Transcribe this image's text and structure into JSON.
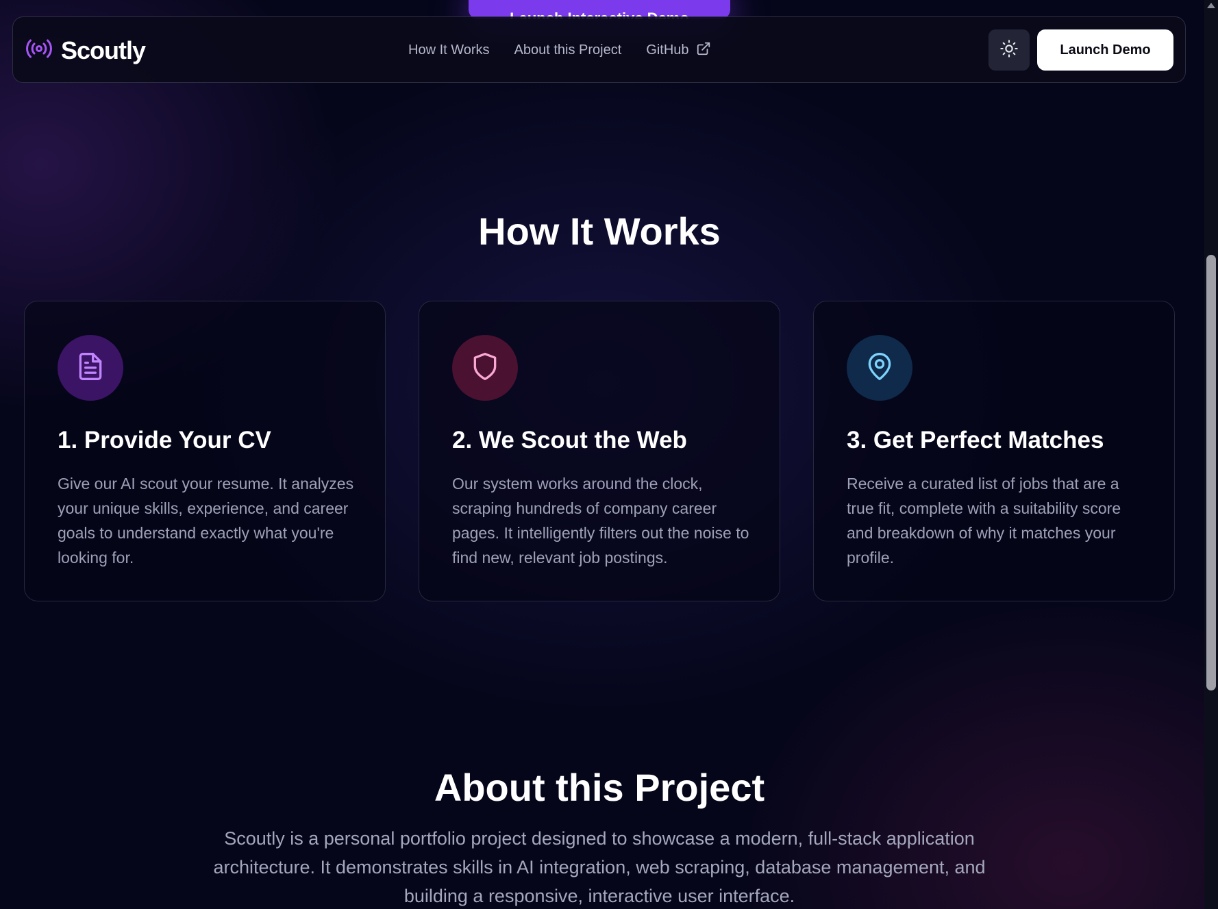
{
  "peek_button": {
    "label": "Launch Interactive Demo"
  },
  "header": {
    "brand": "Scoutly",
    "nav": [
      {
        "label": "How It Works"
      },
      {
        "label": "About this Project"
      },
      {
        "label": "GitHub"
      }
    ],
    "theme_toggle_icon": "sun-icon",
    "launch_label": "Launch Demo"
  },
  "how_it_works": {
    "title": "How It Works",
    "cards": [
      {
        "icon": "document-icon",
        "accent": "#c084fc",
        "title": "1. Provide Your CV",
        "description": "Give our AI scout your resume. It analyzes your unique skills, experience, and career goals to understand exactly what you're looking for."
      },
      {
        "icon": "shield-icon",
        "accent": "#f9a8d4",
        "title": "2. We Scout the Web",
        "description": "Our system works around the clock, scraping hundreds of company career pages. It intelligently filters out the noise to find new, relevant job postings."
      },
      {
        "icon": "map-pin-icon",
        "accent": "#7dd3fc",
        "title": "3. Get Perfect Matches",
        "description": "Receive a curated list of jobs that are a true fit, complete with a suitability score and breakdown of why it matches your profile."
      }
    ]
  },
  "about": {
    "title": "About this Project",
    "description": "Scoutly is a personal portfolio project designed to showcase a modern, full-stack application architecture. It demonstrates skills in AI integration, web scraping, database management, and building a responsive, interactive user interface."
  },
  "colors": {
    "brand_accent": "#a855f7",
    "background": "#05061a",
    "primary_button": "#7c3aed"
  }
}
